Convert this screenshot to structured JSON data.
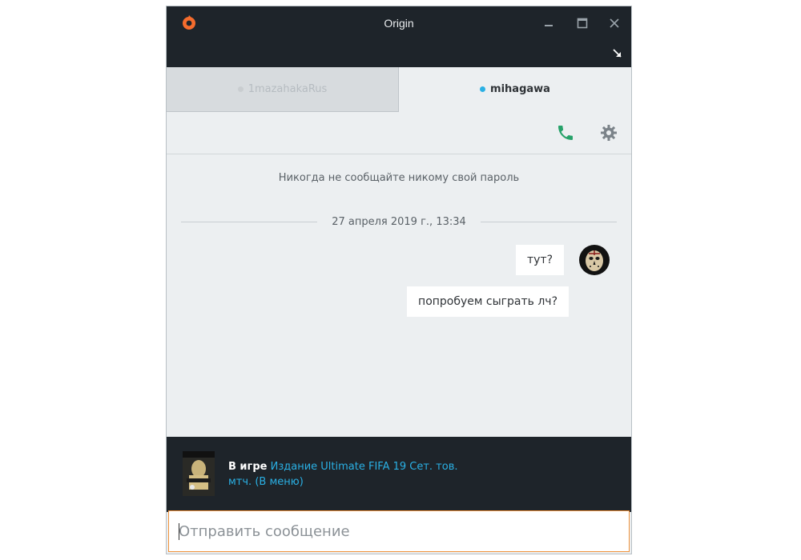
{
  "window": {
    "title": "Origin",
    "accent": "#f56c2d"
  },
  "tabs": [
    {
      "label": "1mazahakaRus",
      "status": "offline",
      "active": false
    },
    {
      "label": "mihagawa",
      "status": "online",
      "active": true
    }
  ],
  "chat": {
    "notice": "Никогда не сообщайте никому свой пароль",
    "date": "27 апреля 2019 г., 13:34",
    "messages": [
      {
        "text": "тут?"
      },
      {
        "text": "попробуем сыграть лч?"
      }
    ]
  },
  "game": {
    "label": "В игре",
    "title_line1": "Издание Ultimate FIFA 19 Сет. тов.",
    "title_line2": "мтч. (В меню)"
  },
  "composer": {
    "placeholder": "Отправить сообщение"
  },
  "colors": {
    "titlebar": "#1e242a",
    "online": "#2ab0e4",
    "call": "#27a26a"
  }
}
